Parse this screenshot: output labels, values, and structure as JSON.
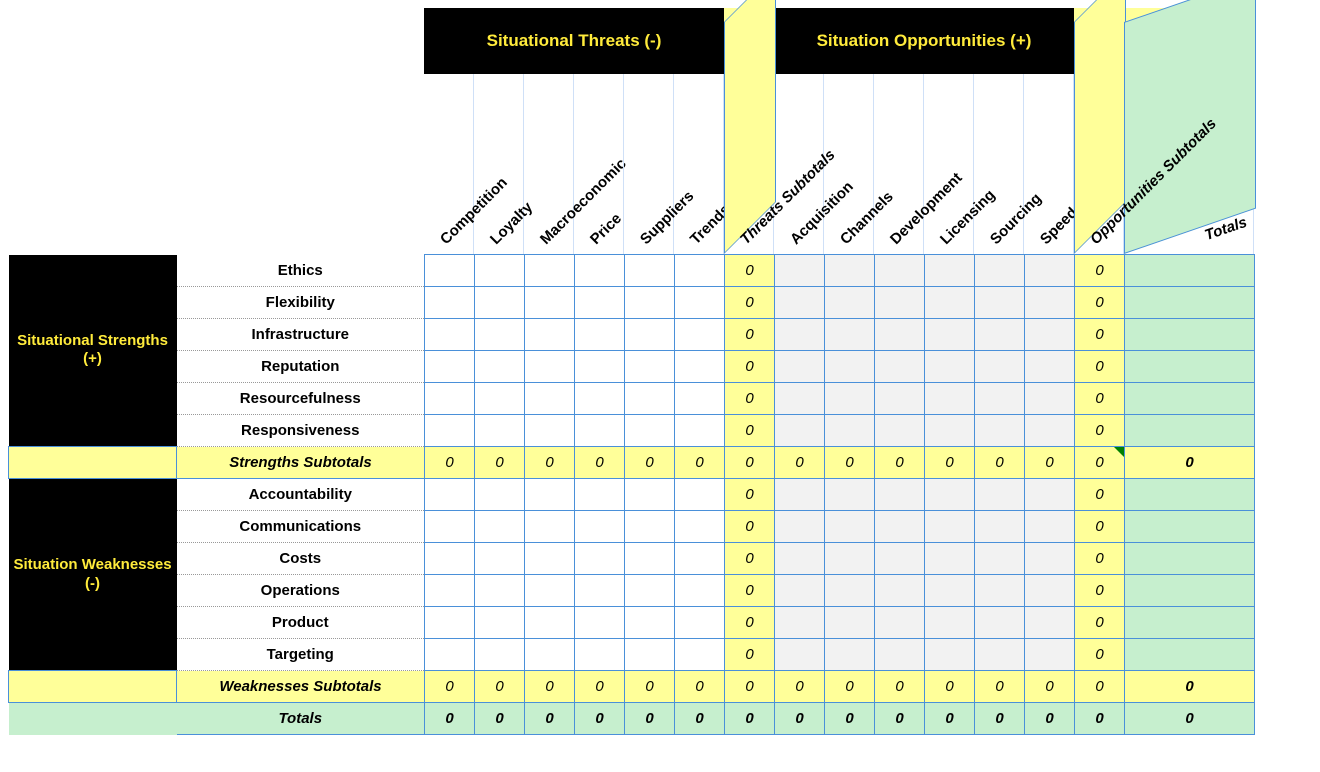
{
  "band": {
    "threats": "Situational Threats (-)",
    "opps": "Situation Opportunities (+)"
  },
  "rowband": {
    "strengths": "Situational Strengths (+)",
    "weaknesses": "Situation Weaknesses (-)"
  },
  "cols": {
    "threats": [
      "Competition",
      "Loyalty",
      "Macroeconomic",
      "Price",
      "Suppliers",
      "Trends"
    ],
    "threats_sub": "Threats Subtotals",
    "opps": [
      "Acquisition",
      "Channels",
      "Development",
      "Licensing",
      "Sourcing",
      "Speed"
    ],
    "opps_sub": "Opportunities Subtotals",
    "totals": "Totals"
  },
  "rows": {
    "strengths": [
      "Ethics",
      "Flexibility",
      "Infrastructure",
      "Reputation",
      "Resourcefulness",
      "Responsiveness"
    ],
    "strengths_sub": "Strengths Subtotals",
    "weaknesses": [
      "Accountability",
      "Communications",
      "Costs",
      "Operations",
      "Product",
      "Targeting"
    ],
    "weaknesses_sub": "Weaknesses Subtotals",
    "totals": "Totals"
  },
  "zero": "0",
  "blank": ""
}
